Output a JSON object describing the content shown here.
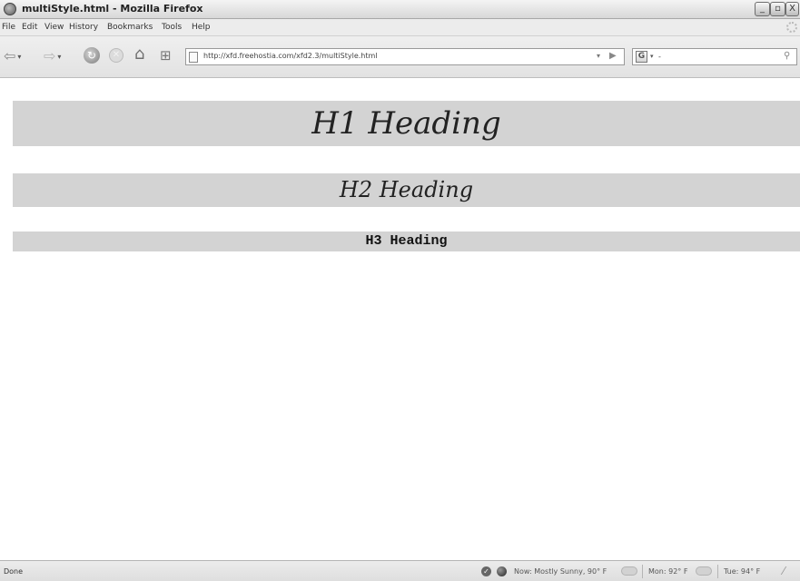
{
  "window": {
    "title": "multiStyle.html - Mozilla Firefox",
    "controls": {
      "minimize": "_",
      "maximize": "▫",
      "close": "X"
    }
  },
  "menu": {
    "items": [
      "File",
      "Edit",
      "View",
      "History",
      "Bookmarks",
      "Tools",
      "Help"
    ]
  },
  "toolbar": {
    "back_glyph": "⇦",
    "forward_glyph": "⇨",
    "reload_glyph": "↻",
    "stop_glyph": "✕",
    "home_glyph": "⌂",
    "bookmark_glyph": "⊞",
    "dropdown_glyph": "▾",
    "go_glyph": "▶"
  },
  "address_bar": {
    "url": "http://xfd.freehostia.com/xfd2.3/multiStyle.html"
  },
  "search_bar": {
    "engine_letter": "G",
    "value": "-",
    "search_glyph": "⚲"
  },
  "page": {
    "h1": "H1 Heading",
    "h2": "H2 Heading",
    "h3": "H3 Heading"
  },
  "status_bar": {
    "status": "Done",
    "weather_now": "Now: Mostly Sunny, 90° F",
    "weather_mon": "Mon: 92° F",
    "weather_tue": "Tue: 94° F"
  }
}
